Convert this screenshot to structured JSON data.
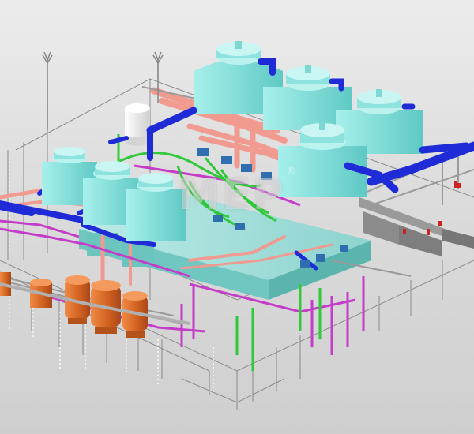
{
  "watermark": {
    "text": "MEP",
    "reg_mark": "®"
  },
  "colors": {
    "background": "#d9d9d9",
    "tower_fill": "#8fe3df",
    "tower_dark": "#5cc7c2",
    "chilled_water_pipe": "#1e2bd6",
    "condenser_pipe": "#f09a90",
    "green_pipe": "#2fc93a",
    "magenta_pipe": "#c43dc9",
    "orange_tank": "#d9682a",
    "white_tank": "#f4f4f4",
    "grey_pipe": "#9a9a9a",
    "pump_blue": "#2f6fb0"
  },
  "components": {
    "cooling_towers": 7,
    "orange_tanks": 4,
    "white_tank": 1,
    "vent_stacks": 2
  }
}
